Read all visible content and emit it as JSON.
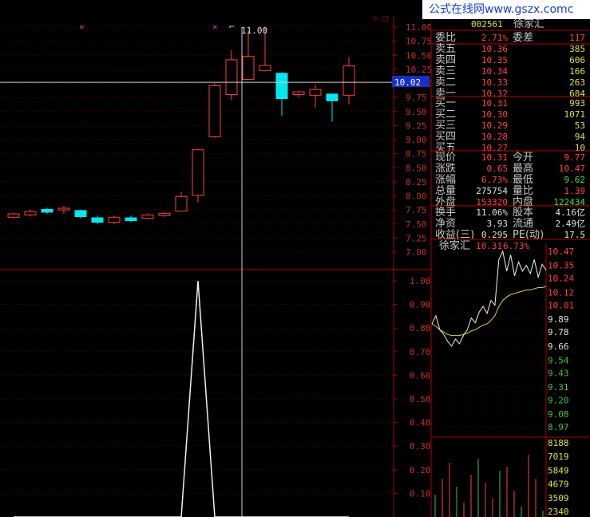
{
  "brand": {
    "site": "公式在线网",
    "url": "www.gszx.com",
    "tail": "c"
  },
  "quote": {
    "code": "002561",
    "name": "徐家汇",
    "weibi_label": "委比",
    "weibi_value": "2.71%",
    "weicha_label": "委差",
    "weicha_value": "117"
  },
  "sell_orders": [
    {
      "label": "卖五",
      "price": "10.36",
      "volume": "385"
    },
    {
      "label": "卖四",
      "price": "10.35",
      "volume": "606"
    },
    {
      "label": "卖三",
      "price": "10.34",
      "volume": "166"
    },
    {
      "label": "卖二",
      "price": "10.33",
      "volume": "263"
    },
    {
      "label": "卖一",
      "price": "10.32",
      "volume": "684"
    }
  ],
  "buy_orders": [
    {
      "label": "买一",
      "price": "10.31",
      "volume": "993"
    },
    {
      "label": "买二",
      "price": "10.30",
      "volume": "1071"
    },
    {
      "label": "买三",
      "price": "10.29",
      "volume": "53"
    },
    {
      "label": "买四",
      "price": "10.28",
      "volume": "94"
    },
    {
      "label": "买五",
      "price": "10.27",
      "volume": "10"
    }
  ],
  "stats": [
    {
      "l1": "现价",
      "v1": "10.31",
      "c1": "#ff4040",
      "l2": "今开",
      "v2": "9.77",
      "c2": "#ff4040"
    },
    {
      "l1": "涨跌",
      "v1": "0.65",
      "c1": "#ff4040",
      "l2": "最高",
      "v2": "10.47",
      "c2": "#ff4040"
    },
    {
      "l1": "涨幅",
      "v1": "6.73%",
      "c1": "#ff4040",
      "l2": "最低",
      "v2": "9.62",
      "c2": "#40e040"
    },
    {
      "l1": "总量",
      "v1": "275754",
      "c1": "#e0e0e0",
      "l2": "量比",
      "v2": "1.39",
      "c2": "#ff4040"
    },
    {
      "l1": "外盘",
      "v1": "153320",
      "c1": "#ff4040",
      "l2": "内盘",
      "v2": "122434",
      "c2": "#40e040"
    }
  ],
  "stats2": [
    {
      "l1": "换手",
      "v1": "11.06%",
      "l2": "股本",
      "v2": "4.16亿"
    },
    {
      "l1": "净资",
      "v1": "3.93",
      "l2": "流通",
      "v2": "2.49亿"
    },
    {
      "l1": "收益(三)",
      "v1": "0.295",
      "l2": "PE(动)",
      "v2": "17.5"
    }
  ],
  "mini_chart": {
    "title": "徐家汇",
    "price": "10.31",
    "change": "6.73%"
  },
  "colors": {
    "up": "#ff4040",
    "down": "#00e8f0",
    "down_text": "#40e040",
    "axis": "#b00000"
  },
  "chart_data": [
    {
      "type": "candlestick",
      "y_ticks": [
        "11.00",
        "10.75",
        "10.50",
        "10.25",
        "10.00",
        "9.75",
        "9.50",
        "9.25",
        "9.00",
        "8.75",
        "8.50",
        "8.25",
        "8.00",
        "7.75",
        "7.50",
        "7.25",
        "7.00"
      ],
      "ylim": [
        7.0,
        11.0
      ],
      "crosshair_value": "10.02",
      "annotation": "11.00",
      "candles": [
        {
          "o": 7.62,
          "c": 7.68,
          "h": 7.7,
          "l": 7.6
        },
        {
          "o": 7.66,
          "c": 7.72,
          "h": 7.76,
          "l": 7.63
        },
        {
          "o": 7.76,
          "c": 7.71,
          "h": 7.79,
          "l": 7.68
        },
        {
          "o": 7.75,
          "c": 7.78,
          "h": 7.82,
          "l": 7.68
        },
        {
          "o": 7.74,
          "c": 7.63,
          "h": 7.75,
          "l": 7.6
        },
        {
          "o": 7.61,
          "c": 7.53,
          "h": 7.65,
          "l": 7.5
        },
        {
          "o": 7.53,
          "c": 7.62,
          "h": 7.65,
          "l": 7.5
        },
        {
          "o": 7.61,
          "c": 7.56,
          "h": 7.65,
          "l": 7.53
        },
        {
          "o": 7.6,
          "c": 7.66,
          "h": 7.69,
          "l": 7.58
        },
        {
          "o": 7.65,
          "c": 7.69,
          "h": 7.72,
          "l": 7.62
        },
        {
          "o": 7.73,
          "c": 7.99,
          "h": 8.07,
          "l": 7.73
        },
        {
          "o": 8.01,
          "c": 8.82,
          "h": 8.82,
          "l": 7.88
        },
        {
          "o": 9.05,
          "c": 9.96,
          "h": 10.0,
          "l": 9.03
        },
        {
          "o": 9.8,
          "c": 10.42,
          "h": 10.6,
          "l": 9.7
        },
        {
          "o": 10.07,
          "c": 10.48,
          "h": 10.93,
          "l": 10.07
        },
        {
          "o": 10.23,
          "c": 10.32,
          "h": 11.0,
          "l": 10.23
        },
        {
          "o": 10.18,
          "c": 9.73,
          "h": 10.2,
          "l": 9.42
        },
        {
          "o": 9.8,
          "c": 9.85,
          "h": 9.87,
          "l": 9.75
        },
        {
          "o": 9.79,
          "c": 9.89,
          "h": 9.98,
          "l": 9.57
        },
        {
          "o": 9.81,
          "c": 9.69,
          "h": 9.82,
          "l": 9.32
        },
        {
          "o": 9.79,
          "c": 10.31,
          "h": 10.47,
          "l": 9.62
        }
      ]
    },
    {
      "type": "line",
      "y_ticks": [
        "1.00",
        "0.90",
        "0.80",
        "0.70",
        "0.60",
        "0.50",
        "0.40",
        "0.30",
        "0.20",
        "0.10"
      ],
      "ylim": [
        0,
        1.0
      ],
      "values": [
        0,
        0,
        0,
        0,
        0,
        0,
        0,
        0,
        0,
        0,
        0,
        1.0,
        0,
        0,
        0,
        0,
        0,
        0,
        0,
        0,
        0
      ]
    },
    {
      "type": "line",
      "title": "徐家汇",
      "price_ticks": [
        "10.47",
        "10.35",
        "10.24",
        "10.12",
        "10.01",
        "9.89",
        "9.78",
        "9.66",
        "9.54",
        "9.43",
        "9.31",
        "9.20",
        "9.08",
        "8.97"
      ],
      "volume_ticks": [
        "8188",
        "7019",
        "5849",
        "4679",
        "3509",
        "2340"
      ],
      "price_ylim": [
        8.97,
        10.47
      ],
      "price": [
        9.85,
        9.92,
        9.8,
        9.76,
        9.7,
        9.66,
        9.72,
        9.68,
        9.75,
        9.8,
        9.9,
        9.86,
        9.95,
        10.0,
        9.94,
        10.05,
        10.01,
        10.4,
        10.47,
        10.3,
        10.44,
        10.26,
        10.38,
        10.3,
        10.35,
        10.28,
        10.4,
        10.25,
        10.36,
        10.31
      ],
      "avg": [
        9.85,
        9.83,
        9.8,
        9.78,
        9.76,
        9.75,
        9.75,
        9.75,
        9.76,
        9.77,
        9.79,
        9.8,
        9.82,
        9.84,
        9.85,
        9.88,
        9.92,
        10.0,
        10.05,
        10.08,
        10.1,
        10.11,
        10.12,
        10.13,
        10.14,
        10.14,
        10.15,
        10.16,
        10.16,
        10.17
      ]
    }
  ]
}
